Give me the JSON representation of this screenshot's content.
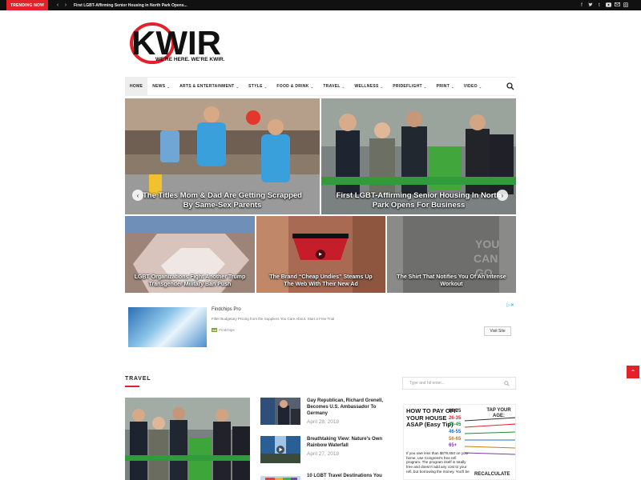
{
  "topbar": {
    "trending_label": "TRENDING NOW",
    "prev": "‹",
    "next": "›",
    "headline": "First LGBT-Affirming Senior Housing in North Park Opens..."
  },
  "social_icons": [
    "facebook-icon",
    "twitter-icon",
    "tumblr-icon",
    "youtube-icon",
    "mail-icon",
    "instagram-icon"
  ],
  "logo": {
    "text": "KWIR",
    "tagline": "WE'RE HERE. WE'RE KWIR."
  },
  "nav": {
    "items": [
      {
        "label": "HOME",
        "caret": ""
      },
      {
        "label": "NEWS",
        "caret": "⌄"
      },
      {
        "label": "ARTS & ENTERTAINMENT",
        "caret": "⌄"
      },
      {
        "label": "STYLE",
        "caret": "⌄"
      },
      {
        "label": "FOOD & DRINK",
        "caret": "⌄"
      },
      {
        "label": "TRAVEL",
        "caret": "⌄"
      },
      {
        "label": "WELLNESS",
        "caret": "⌄"
      },
      {
        "label": "PRIDEFLIGHT",
        "caret": "⌄"
      },
      {
        "label": "PRINT",
        "caret": "⌄"
      },
      {
        "label": "VIDEO",
        "caret": "⌄"
      }
    ]
  },
  "featured": {
    "big": [
      {
        "caption": "The Titles Mom & Dad Are Getting Scrapped By Same-Sex Parents"
      },
      {
        "caption": "First LGBT-Affirming Senior Housing In North Park Opens For Business"
      }
    ],
    "small": [
      {
        "caption": "LGBT Organizations Fight Another Trump Transgender Military Ban Push"
      },
      {
        "caption": "The Brand “Cheap Undies” Steams Up The Web With Their New Ad"
      },
      {
        "caption": "The Shirt That Notifies You Of An Intense Workout"
      }
    ],
    "arrows": {
      "prev": "‹",
      "next": "›"
    },
    "play": "▶"
  },
  "ad": {
    "title": "Findchips Pro",
    "description": "Filter Budgetary Pricing from the Suppliers You Care About. Start a Free Trial",
    "badge": "Ad",
    "brand": "Findchips",
    "button": "Visit Site",
    "choices": "▷✕"
  },
  "travel": {
    "section_title": "TRAVEL",
    "items": [
      {
        "title": "Gay Republican, Richard Grenell, Becomes U.S. Ambassador To Germany",
        "date": "April 28, 2018"
      },
      {
        "title": "Breathtaking View: Nature's Own Rainbow Waterfall",
        "date": "April 27, 2018"
      },
      {
        "title": "10 LGBT Travel Destinations You",
        "date": ""
      }
    ]
  },
  "sidebar": {
    "search_placeholder": "Type and hit enter...",
    "ad": {
      "headline": "HOW TO PAY OFF YOUR HOUSE ASAP (Easy Tip)",
      "tap": "TAP YOUR AGE:",
      "ages": [
        "18-25",
        "26-35",
        "36-45",
        "46-55",
        "56-65",
        "65+"
      ],
      "fine_print": "If you owe less than $679,650 on your home, use Congress's free refi program. The program itself is totally free and doesn't add any cost to your refi, but borrowing the money. You'll be",
      "recalc": "RECALCULATE"
    }
  },
  "colors": {
    "accent": "#e4212b",
    "topbar": "#111111"
  },
  "back_to_top": "⌃"
}
